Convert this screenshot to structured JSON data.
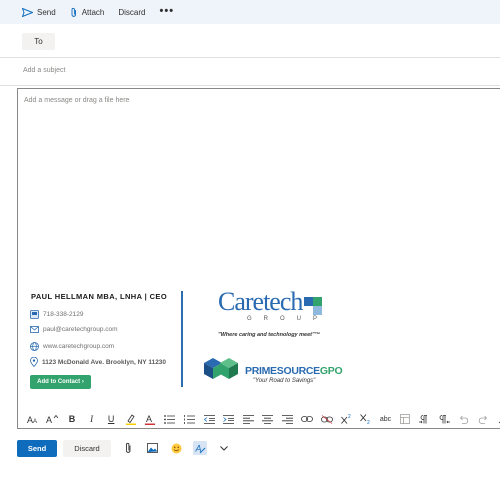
{
  "toolbar": {
    "send_label": "Send",
    "attach_label": "Attach",
    "discard_label": "Discard",
    "more_label": "•••",
    "accent": "#0f6cbd"
  },
  "compose": {
    "to_label": "To",
    "subject_placeholder": "Add a subject",
    "body_placeholder": "Add a message or drag a file here"
  },
  "signature": {
    "name": "PAUL HELLMAN MBA, LNHA | CEO",
    "phone": "718-338-2129",
    "email": "paul@caretechgroup.com",
    "website": "www.caretechgroup.com",
    "address": "1123 McDonald Ave. Brooklyn, NY 11230",
    "contact_button": "Add to Contact ›",
    "caretech_logo": "Caretech",
    "caretech_group": "GROUP",
    "caretech_tagline": "\"Where caring and technology meet\"™",
    "prime_logo": "PRIMESOURCE",
    "prime_logo_gpo": "GPO",
    "prime_tagline": "\"Your Road to Savings\"",
    "brand_blue": "#2a6ab1",
    "brand_green": "#33a36d"
  },
  "format_bar": {
    "icons": [
      "font-size-icon",
      "grow-font-icon",
      "bold-icon",
      "italic-icon",
      "underline-icon",
      "highlight-icon",
      "font-color-icon",
      "bullets-icon",
      "numbering-icon",
      "decrease-indent-icon",
      "increase-indent-icon",
      "align-left-icon",
      "align-center-icon",
      "align-right-icon",
      "link-icon",
      "unlink-icon",
      "superscript-icon",
      "subscript-icon",
      "strikethrough-icon",
      "table-icon",
      "ltr-icon",
      "rtl-icon",
      "undo-icon",
      "redo-icon",
      "more-format-icon"
    ],
    "bold": "B",
    "italic": "I",
    "underline": "U",
    "strike": "abc"
  },
  "bottom": {
    "send_label": "Send",
    "discard_label": "Discard"
  }
}
